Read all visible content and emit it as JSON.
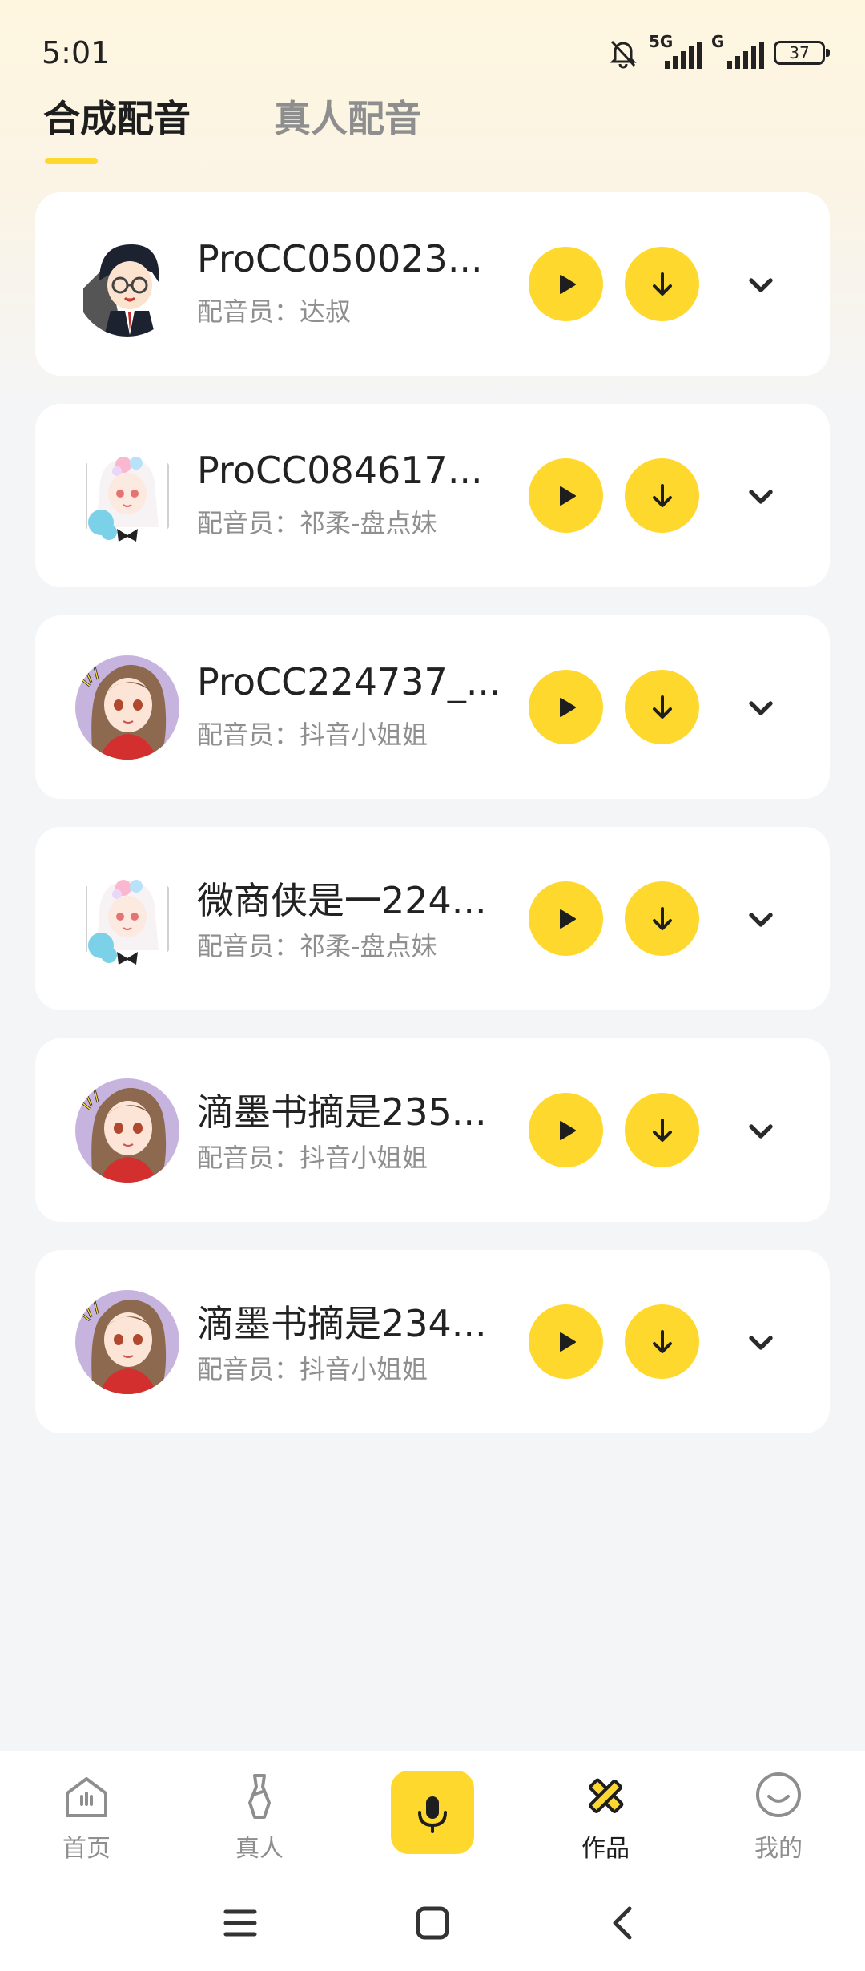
{
  "status_bar": {
    "time": "5:01",
    "network_1": "5G",
    "network_2": "G",
    "battery": "37"
  },
  "tabs": [
    {
      "label": "合成配音",
      "active": true
    },
    {
      "label": "真人配音",
      "active": false
    }
  ],
  "items": [
    {
      "title": "ProCC050023...",
      "voice_label": "配音员：达叔",
      "avatar": "glasses-boy-avatar"
    },
    {
      "title": "ProCC084617...",
      "voice_label": "配音员：祁柔-盘点妹",
      "avatar": "white-hair-girl-avatar"
    },
    {
      "title": "ProCC224737_...",
      "voice_label": "配音员：抖音小姐姐",
      "avatar": "brown-hair-girl-avatar"
    },
    {
      "title": "微商侠是一224...",
      "voice_label": "配音员：祁柔-盘点妹",
      "avatar": "white-hair-girl-avatar"
    },
    {
      "title": "滴墨书摘是235...",
      "voice_label": "配音员：抖音小姐姐",
      "avatar": "brown-hair-girl-avatar"
    },
    {
      "title": "滴墨书摘是234...",
      "voice_label": "配音员：抖音小姐姐",
      "avatar": "brown-hair-girl-avatar"
    }
  ],
  "bottom_nav": [
    {
      "label": "首页",
      "icon": "home-icon",
      "active": false
    },
    {
      "label": "真人",
      "icon": "person-icon",
      "active": false
    },
    {
      "label": "",
      "icon": "mic-icon",
      "active": false
    },
    {
      "label": "作品",
      "icon": "works-icon",
      "active": true
    },
    {
      "label": "我的",
      "icon": "smile-icon",
      "active": false
    }
  ],
  "colors": {
    "accent": "#FFD82E",
    "background": "#F4F5F7",
    "card": "#FFFFFF",
    "text_primary": "#222222",
    "text_secondary": "#8F8F8F"
  }
}
